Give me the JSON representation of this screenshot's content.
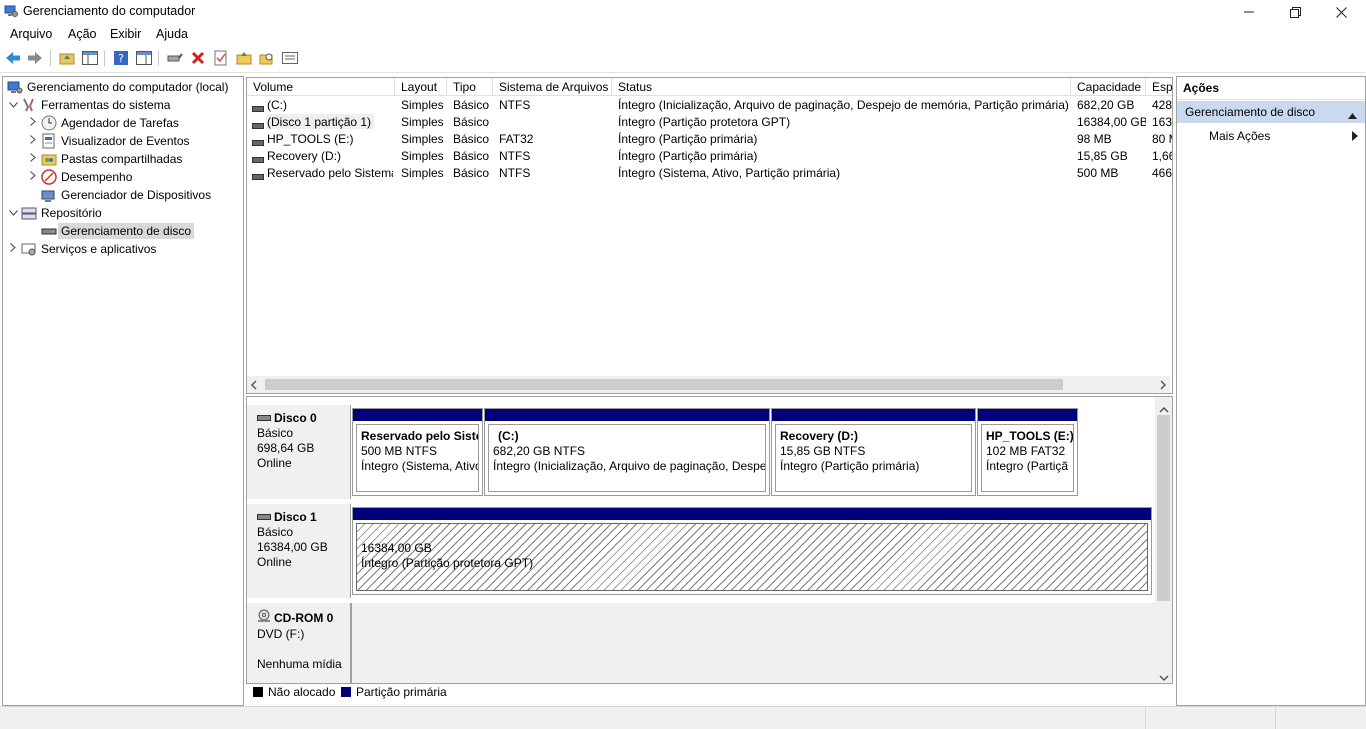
{
  "window": {
    "title": "Gerenciamento do computador"
  },
  "menu": [
    "Arquivo",
    "Ação",
    "Exibir",
    "Ajuda"
  ],
  "toolbar": [
    "back-icon",
    "forward-icon",
    "up-folder-icon",
    "show-hide-tree-icon",
    "help-icon",
    "properties-pane-icon",
    "connect-disk-icon",
    "delete-icon",
    "check-icon",
    "open-folder-icon",
    "search-folder-icon",
    "view-list-icon"
  ],
  "tree": {
    "root": "Gerenciamento do computador (local)",
    "system_tools": "Ferramentas do sistema",
    "task_scheduler": "Agendador de Tarefas",
    "event_viewer": "Visualizador de Eventos",
    "shared_folders": "Pastas compartilhadas",
    "performance": "Desempenho",
    "device_manager": "Gerenciador de Dispositivos",
    "storage": "Repositório",
    "disk_management": "Gerenciamento de disco",
    "services": "Serviços e aplicativos"
  },
  "volume_list": {
    "headers": [
      "Volume",
      "Layout",
      "Tipo",
      "Sistema de Arquivos",
      "Status",
      "Capacidade",
      "Esp"
    ],
    "rows": [
      [
        "(C:)",
        "Simples",
        "Básico",
        "NTFS",
        "Íntegro (Inicialização, Arquivo de paginação, Despejo de memória, Partição primária)",
        "682,20 GB",
        "428,"
      ],
      [
        "(Disco 1 partição 1)",
        "Simples",
        "Básico",
        "",
        "Íntegro (Partição protetora GPT)",
        "16384,00 GB",
        "163"
      ],
      [
        "HP_TOOLS (E:)",
        "Simples",
        "Básico",
        "FAT32",
        "Íntegro (Partição primária)",
        "98 MB",
        "80 M"
      ],
      [
        "Recovery (D:)",
        "Simples",
        "Básico",
        "NTFS",
        "Íntegro (Partição primária)",
        "15,85 GB",
        "1,66"
      ],
      [
        "Reservado pelo Sistema",
        "Simples",
        "Básico",
        "NTFS",
        "Íntegro (Sistema, Ativo, Partição primária)",
        "500 MB",
        "466"
      ]
    ]
  },
  "disks": {
    "disk0": {
      "name": "Disco 0",
      "type": "Básico",
      "size": "698,64 GB",
      "state": "Online",
      "volumes": [
        {
          "name": "Reservado pelo Siste",
          "size": "500 MB NTFS",
          "status": "Íntegro (Sistema, Ativo"
        },
        {
          "name": "(C:)",
          "size": "682,20 GB NTFS",
          "status": "Íntegro (Inicialização, Arquivo de paginação, Despej"
        },
        {
          "name": "Recovery  (D:)",
          "size": "15,85 GB NTFS",
          "status": "Íntegro (Partição primária)"
        },
        {
          "name": "HP_TOOLS  (E:)",
          "size": "102 MB FAT32",
          "status": "Íntegro (Partiçã"
        }
      ]
    },
    "disk1": {
      "name": "Disco 1",
      "type": "Básico",
      "size": "16384,00 GB",
      "state": "Online",
      "volume": {
        "size": "16384,00 GB",
        "status": "Íntegro (Partição protetora GPT)"
      }
    },
    "cdrom0": {
      "name": "CD-ROM 0",
      "type": "DVD (F:)",
      "state": "Nenhuma mídia"
    }
  },
  "legend": {
    "unallocated": "Não alocado",
    "primary": "Partição primária",
    "unallocated_color": "#000000",
    "primary_color": "#00007b"
  },
  "actions": {
    "title": "Ações",
    "section": "Gerenciamento de disco",
    "more": "Mais Ações"
  }
}
